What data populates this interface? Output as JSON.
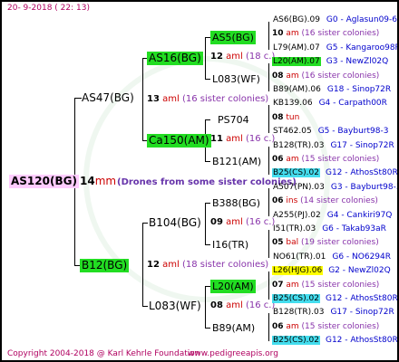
{
  "header": {
    "date": "20- 9-2018 ( 22: 13)"
  },
  "root": {
    "name": "AS120(BG)",
    "year": "14",
    "mark": "mm",
    "drone_note": "(Drones from some sister colonies)"
  },
  "gen1": [
    {
      "name": "AS47(BG)"
    },
    {
      "name": "B12(BG)"
    }
  ],
  "gen2": [
    {
      "name": "AS16(BG)"
    },
    {
      "name": "Ca150(AM)"
    },
    {
      "name": "B104(BG)"
    },
    {
      "name": "L083(WF)"
    }
  ],
  "gen2_info": [
    {
      "year": "13",
      "aml": "aml",
      "sis": "(16 sister colonies)"
    },
    {
      "year": "12",
      "aml": "aml",
      "sis": "(18 sister colonies)"
    }
  ],
  "gen3": [
    {
      "name": "AS5(BG)"
    },
    {
      "name": "L083(WF)"
    },
    {
      "name": "PS704"
    },
    {
      "name": "B121(AM)"
    },
    {
      "name": "B388(BG)"
    },
    {
      "name": "I16(TR)"
    },
    {
      "name": "L20(AM)"
    },
    {
      "name": "B89(AM)"
    }
  ],
  "gen3_info": [
    {
      "year": "12",
      "aml": "aml",
      "sis": "(18 c.)"
    },
    {
      "year": "11",
      "aml": "aml",
      "sis": "(16 c.)"
    },
    {
      "year": "09",
      "aml": "aml",
      "sis": "(16 c.)"
    },
    {
      "year": "08",
      "aml": "aml",
      "sis": "(16 c.)"
    }
  ],
  "gen4": [
    {
      "name": "AS6(BG).09",
      "ind": "G0 - Aglasun09-6",
      "hl": ""
    },
    {
      "year": "10",
      "aml": "am",
      "sis": "(16 sister colonies)"
    },
    {
      "name": "L79(AM).07",
      "ind": "G5 - Kangaroo98R",
      "hl": ""
    },
    {
      "name": "L20(AM).07",
      "ind": "G3 - NewZl02Q",
      "hl": "lime"
    },
    {
      "year": "08",
      "aml": "am",
      "sis": "(16 sister colonies)"
    },
    {
      "name": "B89(AM).06",
      "ind": "G18 - Sinop72R",
      "hl": ""
    },
    {
      "name": "KB139.06",
      "ind": "G4 - Carpath00R",
      "hl": ""
    },
    {
      "year": "08",
      "aml": "tun",
      "sis": ""
    },
    {
      "name": "ST462.05",
      "ind": "G5 - Bayburt98-3",
      "hl": ""
    },
    {
      "name": "B128(TR).03",
      "ind": "G17 - Sinop72R",
      "hl": ""
    },
    {
      "year": "06",
      "aml": "am",
      "sis": "(15 sister colonies)"
    },
    {
      "name": "B25(CS).02",
      "ind": "G12 - AthosSt80R",
      "hl": "cyan"
    },
    {
      "name": "A507(PN).03",
      "ind": "G3 - Bayburt98-3",
      "hl": ""
    },
    {
      "year": "06",
      "aml": "ins",
      "sis": "(14 sister colonies)"
    },
    {
      "name": "A255(PJ).02",
      "ind": "G4 - Cankiri97Q",
      "hl": ""
    },
    {
      "name": "I51(TR).03",
      "ind": "G6 - Takab93aR",
      "hl": ""
    },
    {
      "year": "05",
      "aml": "bal",
      "sis": "(19 sister colonies)"
    },
    {
      "name": "NO61(TR).01",
      "ind": "G6 - NO6294R",
      "hl": ""
    },
    {
      "name": "L26(HJG).06",
      "ind": "G2 - NewZl02Q",
      "hl": "yellow"
    },
    {
      "year": "07",
      "aml": "am",
      "sis": "(15 sister colonies)"
    },
    {
      "name": "B25(CS).02",
      "ind": "G12 - AthosSt80R",
      "hl": "cyan"
    },
    {
      "name": "B128(TR).03",
      "ind": "G17 - Sinop72R",
      "hl": ""
    },
    {
      "year": "06",
      "aml": "am",
      "sis": "(15 sister colonies)"
    },
    {
      "name": "B25(CS).02",
      "ind": "G12 - AthosSt80R",
      "hl": "cyan"
    }
  ],
  "footer": {
    "copyright": "Copyright 2004-2018 @ Karl Kehrle Foundation",
    "url": "www.pedigreeapis.org"
  }
}
